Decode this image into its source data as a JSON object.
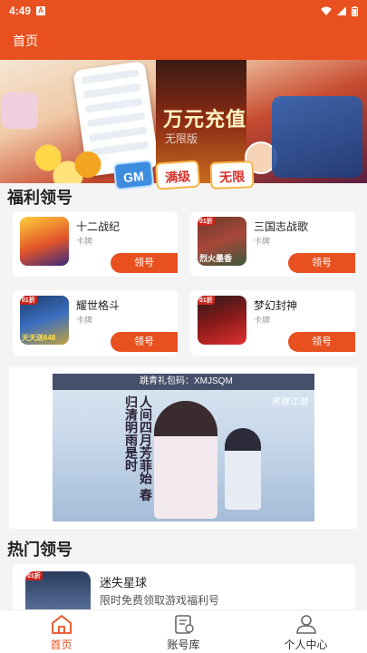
{
  "status": {
    "time": "4:49",
    "notif_icon": "A"
  },
  "appbar": {
    "title": "首页"
  },
  "banner": {
    "title": "万元充值",
    "subtitle": "无限版",
    "tags": [
      "GM",
      "满级",
      "无限"
    ]
  },
  "welfare": {
    "title": "福利领号",
    "items": [
      {
        "name": "十二战纪",
        "category": "卡牌",
        "button": "领号"
      },
      {
        "name": "三国志战歌",
        "category": "卡牌",
        "button": "领号"
      },
      {
        "name": "耀世格斗",
        "category": "卡牌",
        "button": "领号"
      },
      {
        "name": "梦幻封神",
        "category": "卡牌",
        "button": "领号"
      }
    ],
    "icon_badges": [
      "01折",
      "01折",
      "01折"
    ],
    "icon_captions": [
      "烈火墨香",
      "天天送648"
    ]
  },
  "ad": {
    "code_text": "跳青礼包码：XMJSQM",
    "poem": "人间四月芳菲始 春归清明雨是时",
    "logo": "笑傲江湖"
  },
  "hot": {
    "title": "热门领号",
    "items": [
      {
        "name": "迷失星球",
        "desc": "限时免费领取游戏福利号",
        "badge": "01折"
      }
    ]
  },
  "tabs": [
    {
      "label": "首页",
      "icon": "home-icon",
      "active": true
    },
    {
      "label": "账号库",
      "icon": "account-library-icon",
      "active": false
    },
    {
      "label": "个人中心",
      "icon": "person-icon",
      "active": false
    }
  ],
  "colors": {
    "accent": "#e8501f"
  }
}
